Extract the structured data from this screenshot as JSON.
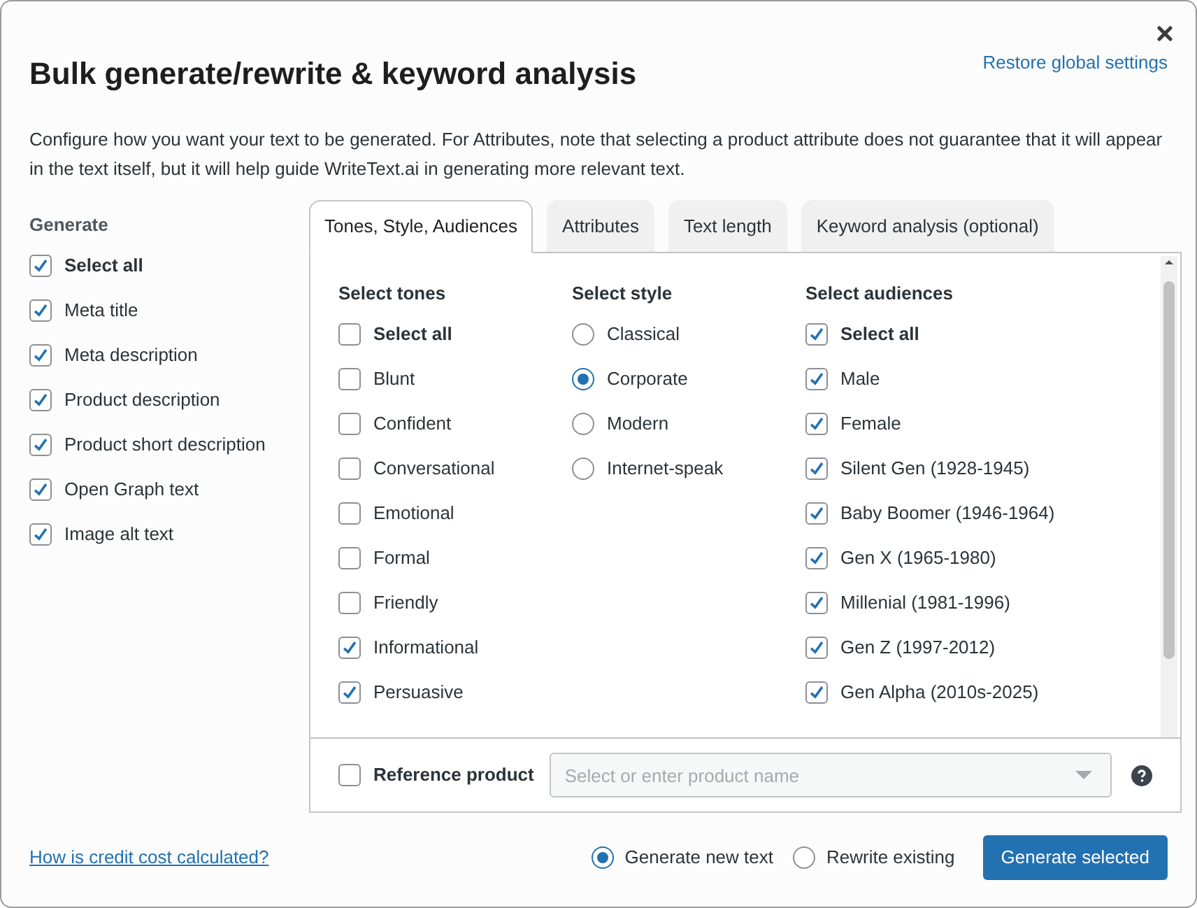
{
  "dialog": {
    "title": "Bulk generate/rewrite & keyword analysis",
    "restore_link": "Restore global settings",
    "description": "Configure how you want your text to be generated. For Attributes, note that selecting a product attribute does not guarantee that it will appear in the text itself, but it will help guide WriteText.ai in generating more relevant text."
  },
  "generate": {
    "heading": "Generate",
    "items": [
      {
        "kind": "select_all",
        "label": "Select all",
        "checked": true
      },
      {
        "kind": "option",
        "label": "Meta title",
        "checked": true
      },
      {
        "kind": "option",
        "label": "Meta description",
        "checked": true
      },
      {
        "kind": "option",
        "label": "Product description",
        "checked": true
      },
      {
        "kind": "option",
        "label": "Product short description",
        "checked": true
      },
      {
        "kind": "option",
        "label": "Open Graph text",
        "checked": true
      },
      {
        "kind": "option",
        "label": "Image alt text",
        "checked": true
      }
    ]
  },
  "tabs": [
    {
      "label": "Tones, Style, Audiences",
      "selected": true
    },
    {
      "label": "Attributes",
      "selected": false
    },
    {
      "label": "Text length",
      "selected": false
    },
    {
      "label": "Keyword analysis (optional)",
      "selected": false
    }
  ],
  "tones": {
    "heading": "Select tones",
    "items": [
      {
        "kind": "select_all",
        "label": "Select all",
        "checked": false
      },
      {
        "kind": "option",
        "label": "Blunt",
        "checked": false
      },
      {
        "kind": "option",
        "label": "Confident",
        "checked": false
      },
      {
        "kind": "option",
        "label": "Conversational",
        "checked": false
      },
      {
        "kind": "option",
        "label": "Emotional",
        "checked": false
      },
      {
        "kind": "option",
        "label": "Formal",
        "checked": false
      },
      {
        "kind": "option",
        "label": "Friendly",
        "checked": false
      },
      {
        "kind": "option",
        "label": "Informational",
        "checked": true
      },
      {
        "kind": "option",
        "label": "Persuasive",
        "checked": true
      }
    ]
  },
  "style": {
    "heading": "Select style",
    "options": [
      {
        "label": "Classical",
        "selected": false
      },
      {
        "label": "Corporate",
        "selected": true
      },
      {
        "label": "Modern",
        "selected": false
      },
      {
        "label": "Internet-speak",
        "selected": false
      }
    ]
  },
  "audiences": {
    "heading": "Select audiences",
    "items": [
      {
        "kind": "select_all",
        "label": "Select all",
        "checked": true
      },
      {
        "kind": "option",
        "label": "Male",
        "checked": true
      },
      {
        "kind": "option",
        "label": "Female",
        "checked": true
      },
      {
        "kind": "option",
        "label": "Silent Gen (1928-1945)",
        "checked": true
      },
      {
        "kind": "option",
        "label": "Baby Boomer (1946-1964)",
        "checked": true
      },
      {
        "kind": "option",
        "label": "Gen X (1965-1980)",
        "checked": true
      },
      {
        "kind": "option",
        "label": "Millenial (1981-1996)",
        "checked": true
      },
      {
        "kind": "option",
        "label": "Gen Z (1997-2012)",
        "checked": true
      },
      {
        "kind": "option",
        "label": "Gen Alpha (2010s-2025)",
        "checked": true
      }
    ]
  },
  "reference_product": {
    "label": "Reference product",
    "checked": false,
    "placeholder": "Select or enter product name"
  },
  "footer": {
    "link": "How is credit cost calculated?",
    "modes": [
      {
        "label": "Generate new text",
        "selected": true
      },
      {
        "label": "Rewrite existing",
        "selected": false
      }
    ],
    "button": "Generate selected"
  }
}
